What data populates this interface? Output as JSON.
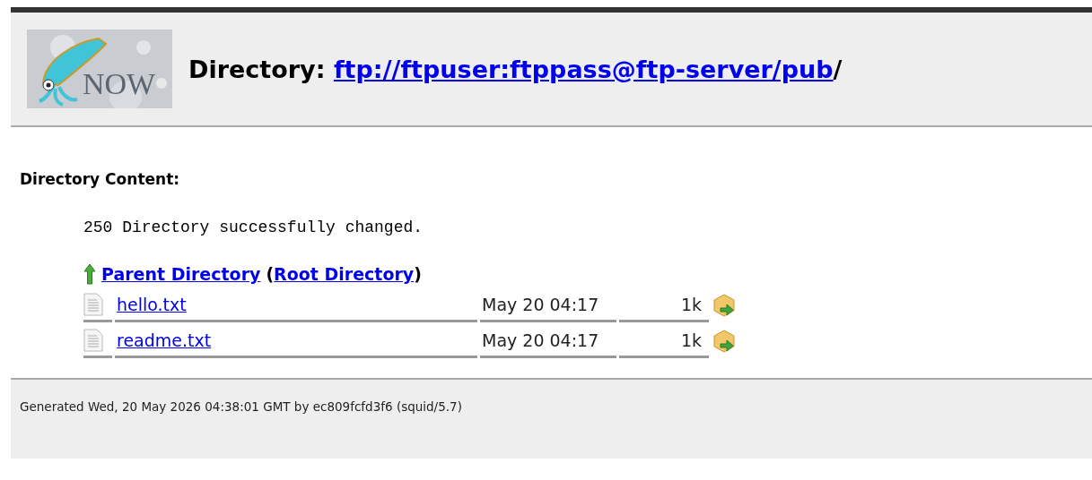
{
  "header": {
    "logo": {
      "text": "NOW"
    },
    "title_prefix": "Directory: ",
    "link": "ftp://ftpuser:ftppass@ftp-server/pub",
    "title_suffix": "/"
  },
  "content": {
    "heading": "Directory Content:",
    "message": "250 Directory successfully changed.",
    "nav": {
      "parent": "Parent Directory",
      "open": "(",
      "root": "Root Directory",
      "close": ")"
    },
    "files": [
      {
        "name": "hello.txt",
        "date": "May 20 04:17",
        "size": "1k"
      },
      {
        "name": "readme.txt",
        "date": "May 20 04:17",
        "size": "1k"
      }
    ]
  },
  "footer": {
    "text": "Generated Wed, 20 May 2026 04:38:01 GMT by ec809fcfd3f6 (squid/5.7)"
  }
}
